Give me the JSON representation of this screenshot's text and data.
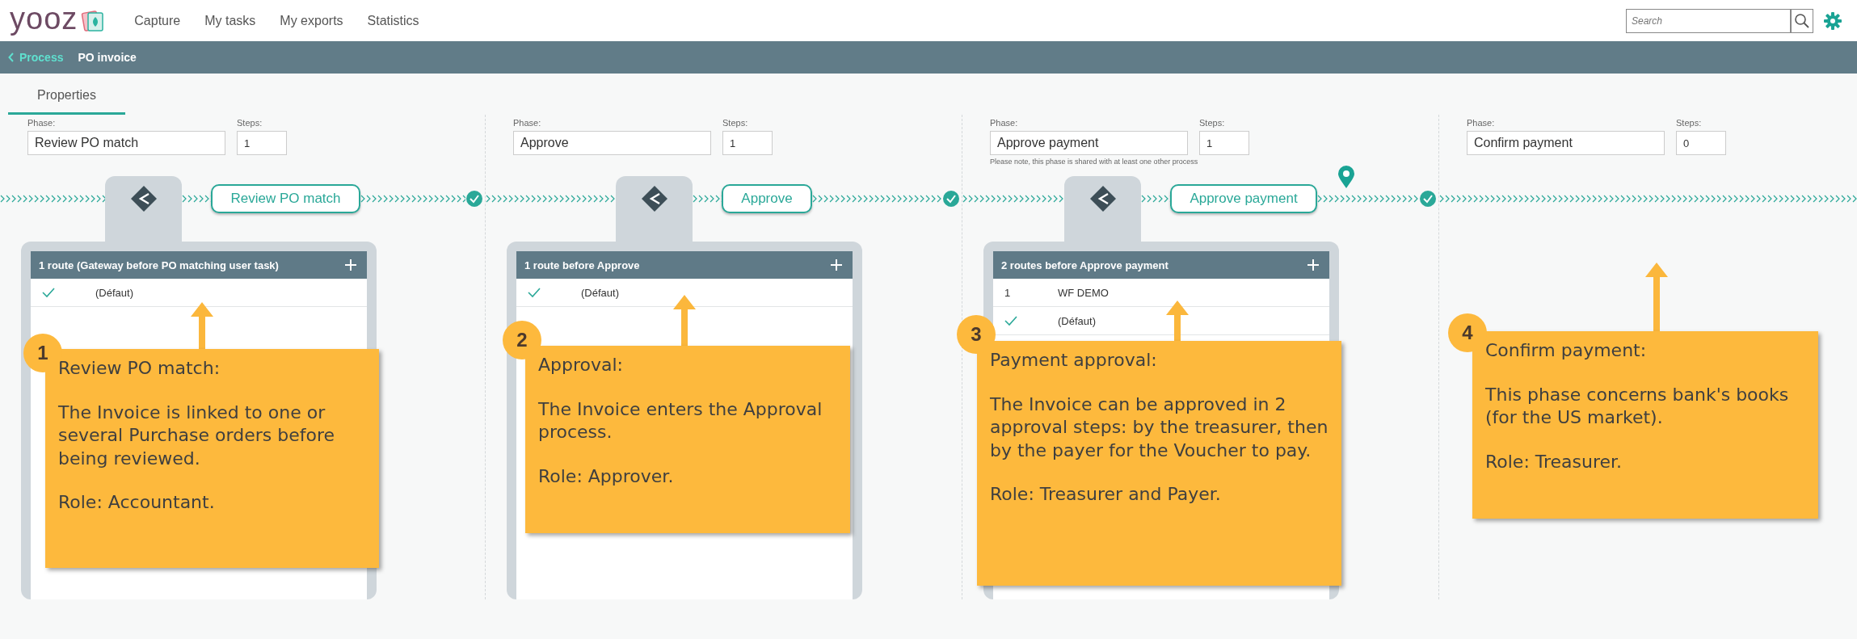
{
  "logo": "yooz",
  "nav": [
    {
      "label": "Capture"
    },
    {
      "label": "My tasks"
    },
    {
      "label": "My exports"
    },
    {
      "label": "Statistics"
    }
  ],
  "search": {
    "placeholder": "Search"
  },
  "breadcrumb": {
    "back": "Process",
    "title": "PO invoice"
  },
  "tabs": [
    {
      "label": "Properties",
      "selected": true
    }
  ],
  "phases": [
    {
      "kind": "gateway",
      "phase_label": "Phase:",
      "phase": "Review PO match",
      "steps_label": "Steps:",
      "steps": "1",
      "pin": false,
      "task": "Review PO match",
      "route_header": "1 route (Gateway before PO matching user task)",
      "routes": [
        {
          "kind": "default",
          "name": "(Défaut)"
        }
      ],
      "callout": {
        "number": "1",
        "paragraphs": [
          "Review PO match:",
          "The Invoice is linked to one or several Purchase orders before being reviewed.",
          "Role: Accountant."
        ]
      }
    },
    {
      "kind": "gateway",
      "phase_label": "Phase:",
      "phase": "Approve",
      "steps_label": "Steps:",
      "steps": "1",
      "pin": false,
      "task": "Approve",
      "route_header": "1 route before Approve",
      "routes": [
        {
          "kind": "default",
          "name": "(Défaut)"
        }
      ],
      "callout": {
        "number": "2",
        "paragraphs": [
          "Approval:",
          "The Invoice enters the Approval process.",
          "Role: Approver."
        ]
      }
    },
    {
      "kind": "gateway",
      "phase_label": "Phase:",
      "phase": "Approve payment",
      "steps_label": "Steps:",
      "steps": "1",
      "note": "Please note, this phase is shared with at least one other process",
      "pin": true,
      "task": "Approve payment",
      "route_header": "2 routes before Approve payment",
      "routes": [
        {
          "kind": "numbered",
          "number": "1",
          "name": "WF DEMO"
        },
        {
          "kind": "default",
          "name": "(Défaut)"
        }
      ],
      "callout": {
        "number": "3",
        "paragraphs": [
          "Payment approval:",
          "The Invoice can be approved in 2 approval steps: by the treasurer, then by the payer for the Voucher to pay.",
          "Role: Treasurer and Payer."
        ]
      }
    },
    {
      "kind": "end",
      "phase_label": "Phase:",
      "phase": "Confirm payment",
      "steps_label": "Steps:",
      "steps": "0",
      "callout": {
        "number": "4",
        "paragraphs": [
          "Confirm payment:",
          "This phase concerns bank's books (for the US market).",
          "Role: Treasurer."
        ]
      }
    }
  ]
}
